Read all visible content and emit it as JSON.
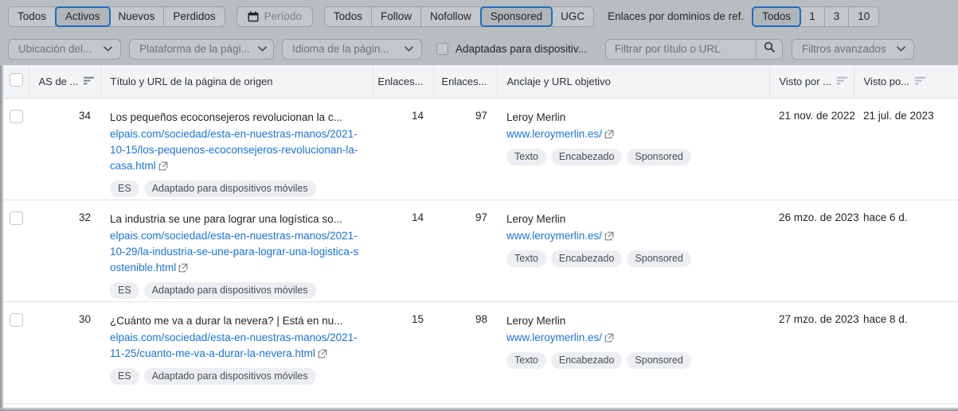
{
  "toolbar": {
    "status_segment": {
      "items": [
        "Todos",
        "Activos",
        "Nuevos",
        "Perdidos"
      ],
      "active": "Activos"
    },
    "period_button": {
      "label": "Período",
      "icon": "calendar-icon"
    },
    "follow_segment": {
      "items": [
        "Todos",
        "Follow",
        "Nofollow",
        "Sponsored",
        "UGC"
      ],
      "active": "Sponsored"
    },
    "links_per_domain": {
      "label": "Enlaces por dominios de ref.",
      "items": [
        "Todos",
        "1",
        "3",
        "10"
      ],
      "active": "Todos"
    },
    "dropdowns": [
      {
        "label": "Ubicación del...",
        "icon": "chevron-down-icon"
      },
      {
        "label": "Plataforma de la pági...",
        "icon": "chevron-down-icon"
      },
      {
        "label": "Idioma de la págin...",
        "icon": "chevron-down-icon"
      }
    ],
    "mobile_checkbox": {
      "label": "Adaptadas para dispositiv...",
      "checked": false
    },
    "search": {
      "placeholder": "Filtrar por título o URL",
      "value": "",
      "icon": "search-icon"
    },
    "advanced_filters": {
      "label": "Filtros avanzados",
      "icon": "chevron-down-icon"
    }
  },
  "table": {
    "headers": {
      "as": "AS de ...",
      "title": "Título y URL de la página de origen",
      "links1": "Enlaces...",
      "links2": "Enlaces...",
      "anchor": "Anclaje y URL objetivo",
      "seen1": "Visto por ...",
      "seen2": "Visto po..."
    },
    "rows": [
      {
        "as": "34",
        "title": "Los pequeños ecoconsejeros revolucionan la c...",
        "url": "elpais.com/sociedad/esta-en-nuestras-manos/2021-10-15/los-pequenos-ecoconsejeros-revolucionan-la-casa.html",
        "page_tags": [
          "ES",
          "Adaptado para dispositivos móviles"
        ],
        "links1": "14",
        "links2": "97",
        "anchor_name": "Leroy Merlin",
        "anchor_url": "www.leroymerlin.es/",
        "anchor_tags": [
          "Texto",
          "Encabezado",
          "Sponsored"
        ],
        "seen_first": "21 nov. de 2022",
        "seen_last": "21 jul. de 2023"
      },
      {
        "as": "32",
        "title": "La industria se une para lograr una logística so...",
        "url": "elpais.com/sociedad/esta-en-nuestras-manos/2021-10-29/la-industria-se-une-para-lograr-una-logistica-sostenible.html",
        "page_tags": [
          "ES",
          "Adaptado para dispositivos móviles"
        ],
        "links1": "14",
        "links2": "97",
        "anchor_name": "Leroy Merlin",
        "anchor_url": "www.leroymerlin.es/",
        "anchor_tags": [
          "Texto",
          "Encabezado",
          "Sponsored"
        ],
        "seen_first": "26 mzo. de 2023",
        "seen_last": "hace 6 d."
      },
      {
        "as": "30",
        "title": "¿Cuánto me va a durar la nevera? | Está en nu...",
        "url": "elpais.com/sociedad/esta-en-nuestras-manos/2021-11-25/cuanto-me-va-a-durar-la-nevera.html",
        "page_tags": [
          "ES",
          "Adaptado para dispositivos móviles"
        ],
        "links1": "15",
        "links2": "98",
        "anchor_name": "Leroy Merlin",
        "anchor_url": "www.leroymerlin.es/",
        "anchor_tags": [
          "Texto",
          "Encabezado",
          "Sponsored"
        ],
        "seen_first": "27 mzo. de 2023",
        "seen_last": "hace 8 d."
      }
    ]
  },
  "colors": {
    "accent_blue": "#1c6ec4",
    "link_blue": "#1b73d6",
    "toolbar_bg": "#b9bdc1",
    "header_bg": "#f3f4f6"
  }
}
